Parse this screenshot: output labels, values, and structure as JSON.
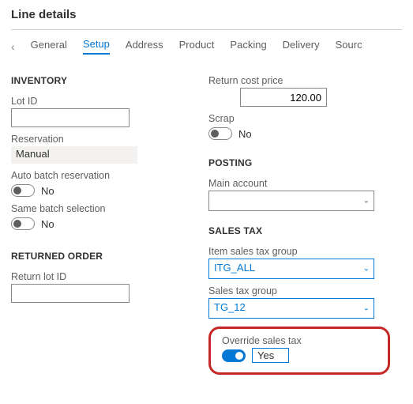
{
  "title": "Line details",
  "tabs": {
    "items": [
      "General",
      "Setup",
      "Address",
      "Product",
      "Packing",
      "Delivery",
      "Sourc"
    ],
    "active_index": 1
  },
  "inventory": {
    "heading": "INVENTORY",
    "lot_id_label": "Lot ID",
    "lot_id_value": "",
    "reservation_label": "Reservation",
    "reservation_value": "Manual",
    "auto_batch_label": "Auto batch reservation",
    "auto_batch_value": "No",
    "same_batch_label": "Same batch selection",
    "same_batch_value": "No"
  },
  "returned_order": {
    "heading": "RETURNED ORDER",
    "return_lot_label": "Return lot ID",
    "return_lot_value": ""
  },
  "return_cost": {
    "label": "Return cost price",
    "value": "120.00"
  },
  "scrap": {
    "label": "Scrap",
    "value": "No"
  },
  "posting": {
    "heading": "POSTING",
    "main_account_label": "Main account",
    "main_account_value": ""
  },
  "sales_tax": {
    "heading": "SALES TAX",
    "item_group_label": "Item sales tax group",
    "item_group_value": "ITG_ALL",
    "group_label": "Sales tax group",
    "group_value": "TG_12",
    "override_label": "Override sales tax",
    "override_value": "Yes"
  }
}
